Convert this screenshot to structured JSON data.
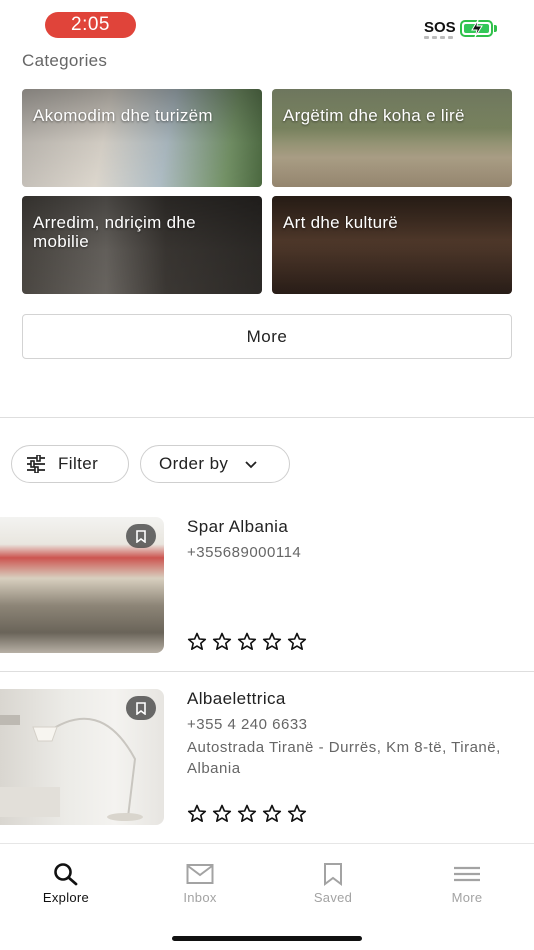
{
  "status_bar": {
    "time": "2:05",
    "sos": "SOS"
  },
  "categories": {
    "title": "Categories",
    "items": [
      {
        "label": "Akomodim dhe turizëm"
      },
      {
        "label": "Argëtim dhe koha e lirë"
      },
      {
        "label": "Arredim, ndriçim dhe mobilie"
      },
      {
        "label": "Art dhe kulturë"
      }
    ],
    "more_label": "More"
  },
  "filters": {
    "filter_label": "Filter",
    "order_label": "Order by"
  },
  "listings": [
    {
      "name": "Spar Albania",
      "phone": "+355689000114",
      "address": "",
      "rating": 0
    },
    {
      "name": "Albaelettrica",
      "phone": "+355 4 240 6633",
      "address": "Autostrada Tiranë - Durrës, Km 8-të, Tiranë, Albania",
      "rating": 0
    }
  ],
  "tabs": [
    {
      "label": "Explore",
      "icon": "search-icon",
      "active": true
    },
    {
      "label": "Inbox",
      "icon": "mail-icon",
      "active": false
    },
    {
      "label": "Saved",
      "icon": "bookmark-icon",
      "active": false
    },
    {
      "label": "More",
      "icon": "menu-icon",
      "active": false
    }
  ],
  "colors": {
    "time_pill": "#e0443a",
    "battery": "#34c759"
  }
}
